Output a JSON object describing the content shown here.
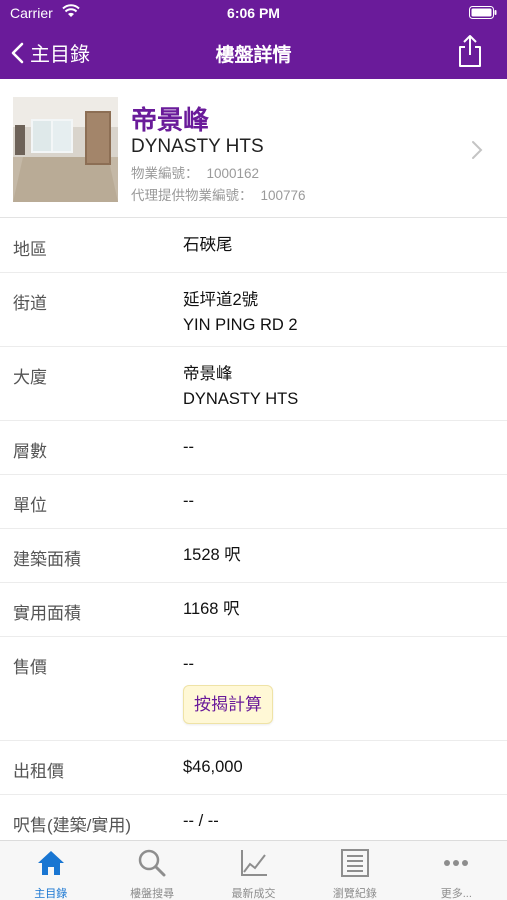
{
  "status_bar": {
    "carrier": "Carrier",
    "time": "6:06 PM"
  },
  "nav": {
    "back_label": "主目錄",
    "title": "樓盤詳情"
  },
  "property": {
    "name_zh": "帝景峰",
    "name_en": "DYNASTY HTS",
    "ref_label": "物業編號：",
    "ref_value": "1000162",
    "agent_ref_label": "代理提供物業編號：",
    "agent_ref_value": "100776"
  },
  "details": [
    {
      "label": "地區",
      "value": "石硤尾"
    },
    {
      "label": "街道",
      "value": "延坪道2號",
      "value2": "YIN PING RD 2"
    },
    {
      "label": "大廈",
      "value": "帝景峰",
      "value2": "DYNASTY HTS"
    },
    {
      "label": "層數",
      "value": "--"
    },
    {
      "label": "單位",
      "value": "--"
    },
    {
      "label": "建築面積",
      "value": "1528 呎"
    },
    {
      "label": "實用面積",
      "value": "1168 呎"
    },
    {
      "label": "售價",
      "value": "--",
      "button": "按揭計算"
    },
    {
      "label": "出租價",
      "value": "$46,000"
    },
    {
      "label": "呎售(建築/實用)",
      "value": "-- / --"
    }
  ],
  "tabs": [
    {
      "label": "主目錄",
      "icon": "home-icon",
      "active": true
    },
    {
      "label": "樓盤搜尋",
      "icon": "search-icon"
    },
    {
      "label": "最新成交",
      "icon": "chart-icon"
    },
    {
      "label": "瀏覽紀錄",
      "icon": "history-list-icon"
    },
    {
      "label": "更多...",
      "icon": "more-icon"
    }
  ],
  "colors": {
    "header": "#6a1b9a",
    "accent": "#6a1b9a",
    "tab_active": "#1976d2",
    "button_bg": "#fff8d6"
  }
}
